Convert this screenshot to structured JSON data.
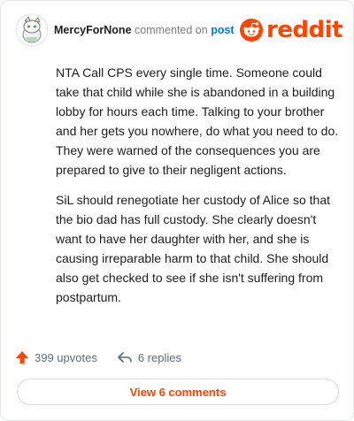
{
  "comment": {
    "username": "MercyForNone",
    "commented_text": "commented on",
    "post_link": "post",
    "paragraphs": [
      "NTA Call CPS every single time. Someone could take that child while she is abandoned in a building lobby for hours each time. Talking to your brother and her gets you nowhere, do what you need to do. They were warned of the consequences you are prepared to give to their negligent actions.",
      "SiL should renegotiate her custody of Alice so that the bio dad has full custody. She clearly doesn't want to have her daughter with her, and she is causing irreparable harm to that child. She should also get checked to see if she isn't suffering from postpartum."
    ]
  },
  "brand": {
    "logo_text": "reddit",
    "accent": "#ff4500",
    "link": "#0079d3"
  },
  "actions": {
    "upvotes": "399 upvotes",
    "replies": "6 replies",
    "view_comments": "View 6 comments"
  },
  "icons": {
    "avatar": "snoo-avatar-icon",
    "logo": "reddit-snoo-icon",
    "upvote": "upvote-arrow-icon",
    "reply": "reply-arrow-icon"
  }
}
